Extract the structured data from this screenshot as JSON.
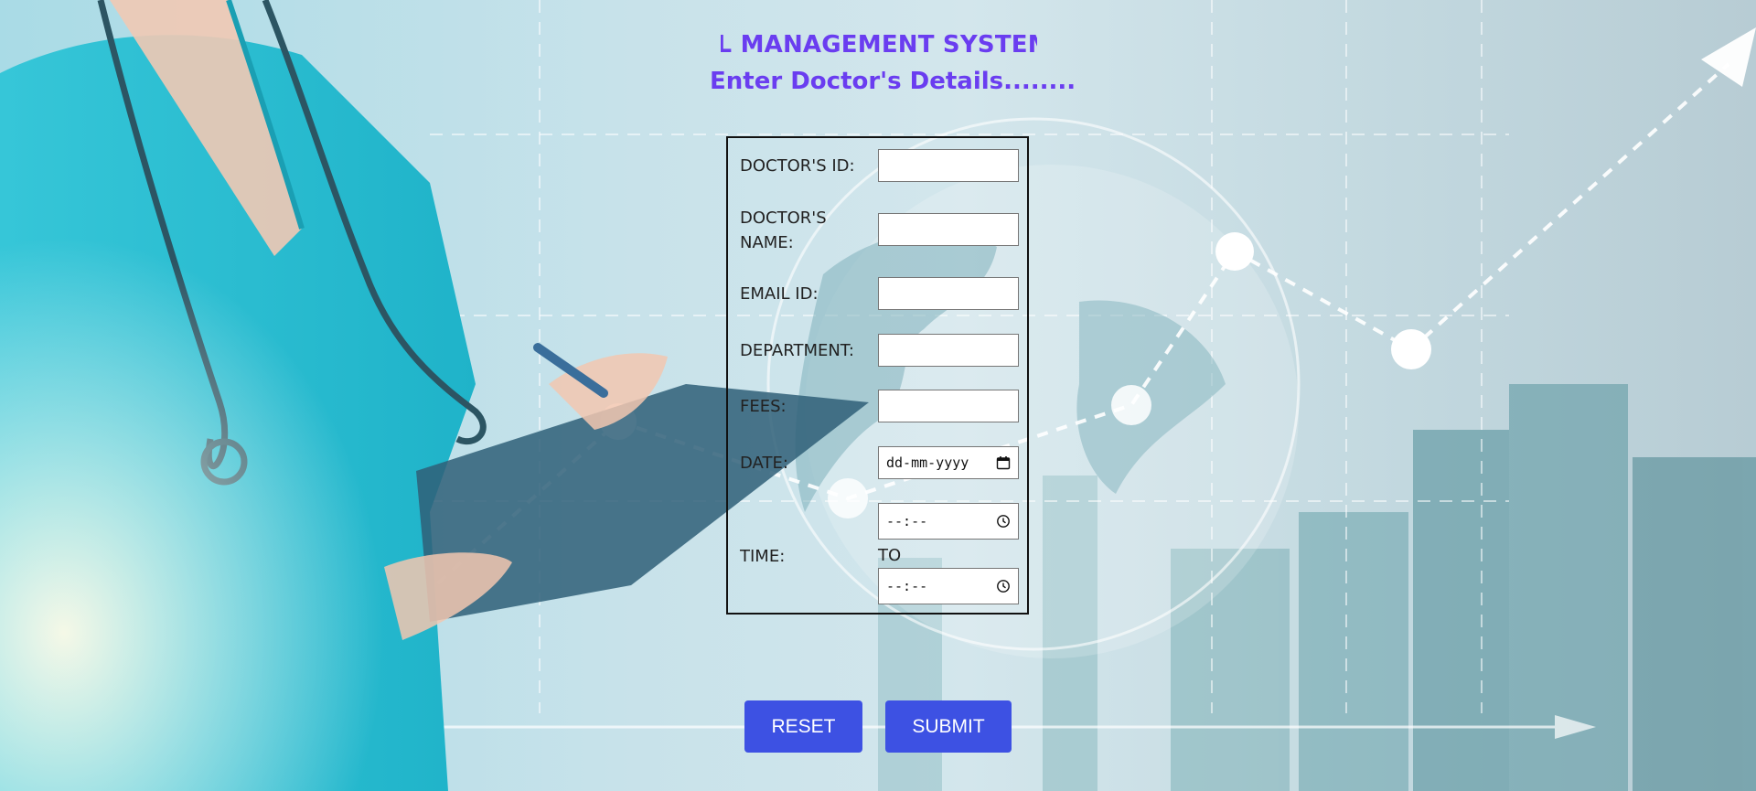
{
  "header": {
    "marquee_title": "HOSPITAL MANAGEMENT SYSTEM",
    "subtitle": "Enter Doctor's Details........"
  },
  "form": {
    "fields": [
      {
        "label": "DOCTOR'S ID:",
        "value": ""
      },
      {
        "label": "DOCTOR'S NAME:",
        "value": ""
      },
      {
        "label": "EMAIL ID:",
        "value": ""
      },
      {
        "label": "DEPARTMENT:",
        "value": ""
      },
      {
        "label": "FEES:",
        "value": ""
      }
    ],
    "date": {
      "label": "DATE:",
      "placeholder": "dd-mm-yyyy"
    },
    "time": {
      "label": "TIME:",
      "from_placeholder": "--:--",
      "to_label": "TO",
      "to_placeholder": "--:--"
    }
  },
  "buttons": {
    "reset": "RESET",
    "submit": "SUBMIT"
  },
  "colors": {
    "title": "#6a3df0",
    "button": "#3d51e3",
    "form_border": "#111111"
  },
  "icons": {
    "date_picker": "calendar-icon",
    "time_picker": "clock-icon"
  }
}
